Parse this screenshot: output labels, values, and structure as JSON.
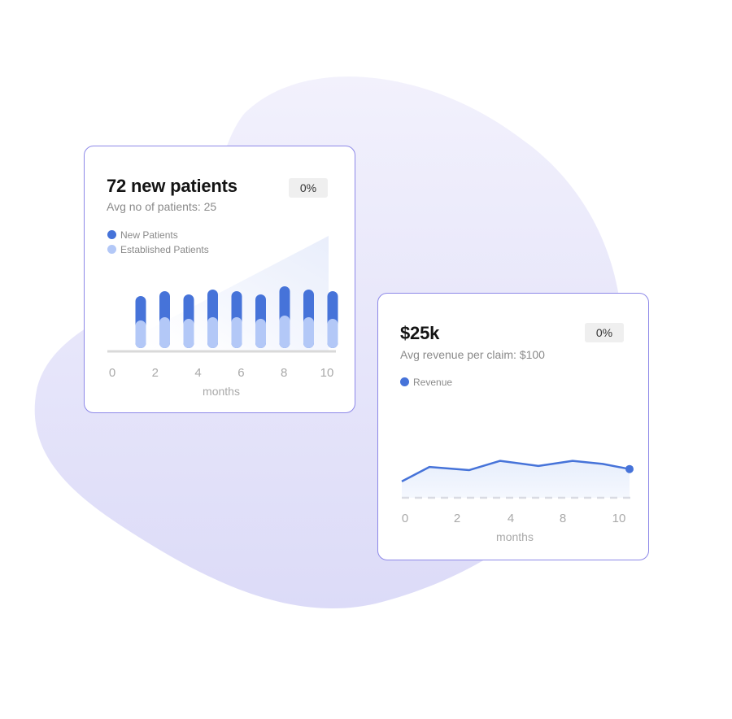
{
  "colors": {
    "new_patients": "#4673d9",
    "established_patients": "#b3c8f7",
    "revenue": "#4673d9",
    "card_border": "#8d88e8"
  },
  "chart_data": [
    {
      "type": "bar",
      "title": "72 new patients",
      "subtitle": "Avg no of patients: 25",
      "badge": "0%",
      "xlabel": "months",
      "ylabel": "",
      "x_ticks": [
        "0",
        "2",
        "4",
        "6",
        "8",
        "10"
      ],
      "xlim": [
        0,
        10
      ],
      "ylim": [
        0,
        40
      ],
      "stacked": true,
      "x": [
        1,
        2,
        3,
        4,
        5,
        6,
        7,
        8,
        9
      ],
      "legend": [
        "New Patients",
        "Established Patients"
      ],
      "series": [
        {
          "name": "Established Patients",
          "values": [
            17,
            19,
            18,
            19,
            19,
            18,
            20,
            19,
            18
          ]
        },
        {
          "name": "New Patients",
          "values": [
            15,
            16,
            15,
            17,
            16,
            15,
            18,
            17,
            17
          ]
        }
      ]
    },
    {
      "type": "line",
      "title": "$25k",
      "subtitle": "Avg revenue per claim: $100",
      "badge": "0%",
      "xlabel": "months",
      "ylabel": "",
      "x_ticks": [
        "0",
        "2",
        "4",
        "8",
        "10"
      ],
      "xlim": [
        0,
        10
      ],
      "ylim": [
        0,
        40
      ],
      "legend": [
        "Revenue"
      ],
      "series": [
        {
          "name": "Revenue",
          "x": [
            0,
            1,
            2,
            3,
            4,
            5,
            6,
            7,
            8
          ],
          "values": [
            8,
            22,
            19,
            28,
            23,
            28,
            25,
            20,
            20
          ]
        }
      ]
    }
  ]
}
